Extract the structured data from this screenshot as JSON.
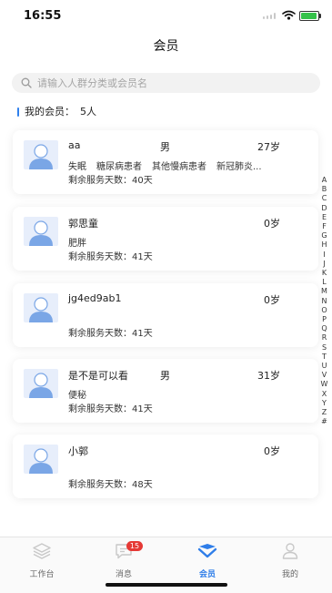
{
  "status_bar": {
    "time": "16:55"
  },
  "header": {
    "title": "会员"
  },
  "search": {
    "placeholder": "请输入人群分类或会员名"
  },
  "summary": {
    "label": "我的会员：",
    "count": "5人"
  },
  "members": [
    {
      "name": "aa",
      "gender": "男",
      "age": "27岁",
      "tags": [
        "失眠",
        "糖尿病患者",
        "其他慢病患者",
        "新冠肺炎..."
      ],
      "remaining": "剩余服务天数：40天"
    },
    {
      "name": "郭思童",
      "gender": "",
      "age": "0岁",
      "tags": [
        "肥胖"
      ],
      "remaining": "剩余服务天数：41天"
    },
    {
      "name": "jg4ed9ab1",
      "gender": "",
      "age": "0岁",
      "tags": [],
      "remaining": "剩余服务天数：41天"
    },
    {
      "name": "是不是可以看",
      "gender": "男",
      "age": "31岁",
      "tags": [
        "便秘"
      ],
      "remaining": "剩余服务天数：41天"
    },
    {
      "name": "小郭",
      "gender": "",
      "age": "0岁",
      "tags": [],
      "remaining": "剩余服务天数：48天"
    }
  ],
  "alpha_index": [
    "A",
    "B",
    "C",
    "D",
    "E",
    "F",
    "G",
    "H",
    "I",
    "J",
    "K",
    "L",
    "M",
    "N",
    "O",
    "P",
    "Q",
    "R",
    "S",
    "T",
    "U",
    "V",
    "W",
    "X",
    "Y",
    "Z",
    "#"
  ],
  "tabbar": {
    "items": [
      {
        "label": "工作台",
        "icon": "workbench-icon"
      },
      {
        "label": "消息",
        "icon": "message-icon",
        "badge": "15"
      },
      {
        "label": "会员",
        "icon": "member-icon"
      },
      {
        "label": "我的",
        "icon": "profile-icon"
      }
    ],
    "active_color": "#2f7ee9"
  },
  "colors": {
    "accent": "#2f80ed",
    "badge": "#e53935"
  }
}
